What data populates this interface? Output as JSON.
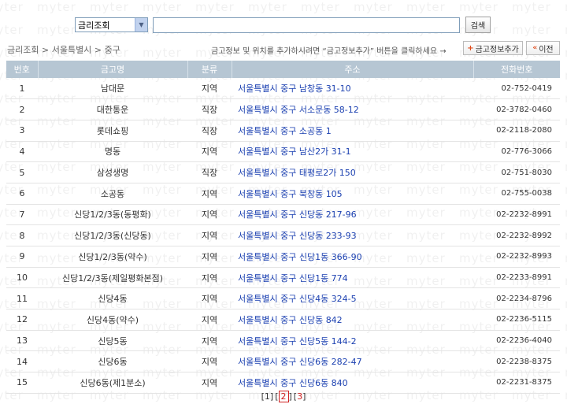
{
  "search": {
    "category_selected": "금리조회",
    "query": "",
    "button_label": "검색"
  },
  "breadcrumb": {
    "items": [
      "금리조회",
      "서울특별시",
      "중구"
    ],
    "separator": ">"
  },
  "notice": {
    "text": "금고정보 및 위치를 추가하시려면 “금고정보추가” 버튼을 클릭하세요 →"
  },
  "actions": {
    "add_label": "금고정보추가",
    "back_label": "이전"
  },
  "table": {
    "headers": [
      "번호",
      "금고명",
      "분류",
      "주소",
      "전화번호"
    ],
    "rows": [
      {
        "no": "1",
        "name": "남대문",
        "type": "지역",
        "addr": "서울특별시 중구 남창동 31-10",
        "tel": "02-752-0419"
      },
      {
        "no": "2",
        "name": "대한통운",
        "type": "직장",
        "addr": "서울특별시 중구 서소문동 58-12",
        "tel": "02-3782-0460"
      },
      {
        "no": "3",
        "name": "롯데쇼핑",
        "type": "직장",
        "addr": "서울특별시 중구 소공동 1",
        "tel": "02-2118-2080"
      },
      {
        "no": "4",
        "name": "명동",
        "type": "지역",
        "addr": "서울특별시 중구 남산2가 31-1",
        "tel": "02-776-3066"
      },
      {
        "no": "5",
        "name": "삼성생명",
        "type": "직장",
        "addr": "서울특별시 중구 태평로2가 150",
        "tel": "02-751-8030"
      },
      {
        "no": "6",
        "name": "소공동",
        "type": "지역",
        "addr": "서울특별시 중구 북창동 105",
        "tel": "02-755-0038"
      },
      {
        "no": "7",
        "name": "신당1/2/3동(동평화)",
        "type": "지역",
        "addr": "서울특별시 중구 신당동 217-96",
        "tel": "02-2232-8991"
      },
      {
        "no": "8",
        "name": "신당1/2/3동(신당동)",
        "type": "지역",
        "addr": "서울특별시 중구 신당동 233-93",
        "tel": "02-2232-8992"
      },
      {
        "no": "9",
        "name": "신당1/2/3동(약수)",
        "type": "지역",
        "addr": "서울특별시 중구 신당1동 366-90",
        "tel": "02-2232-8993"
      },
      {
        "no": "10",
        "name": "신당1/2/3동(제일평화본점)",
        "type": "지역",
        "addr": "서울특별시 중구 신당1동 774",
        "tel": "02-2233-8991"
      },
      {
        "no": "11",
        "name": "신당4동",
        "type": "지역",
        "addr": "서울특별시 중구 신당4동 324-5",
        "tel": "02-2234-8796"
      },
      {
        "no": "12",
        "name": "신당4동(약수)",
        "type": "지역",
        "addr": "서울특별시 중구 신당동 842",
        "tel": "02-2236-5115"
      },
      {
        "no": "13",
        "name": "신당5동",
        "type": "지역",
        "addr": "서울특별시 중구 신당5동 144-2",
        "tel": "02-2236-4040"
      },
      {
        "no": "14",
        "name": "신당6동",
        "type": "지역",
        "addr": "서울특별시 중구 신당6동 282-47",
        "tel": "02-2238-8375"
      },
      {
        "no": "15",
        "name": "신당6동(제1분소)",
        "type": "지역",
        "addr": "서울특별시 중구 신당6동 840",
        "tel": "02-2231-8375"
      }
    ]
  },
  "pagination": {
    "pages": [
      "1",
      "2",
      "3"
    ],
    "current": "2"
  },
  "watermark_text": "myter"
}
